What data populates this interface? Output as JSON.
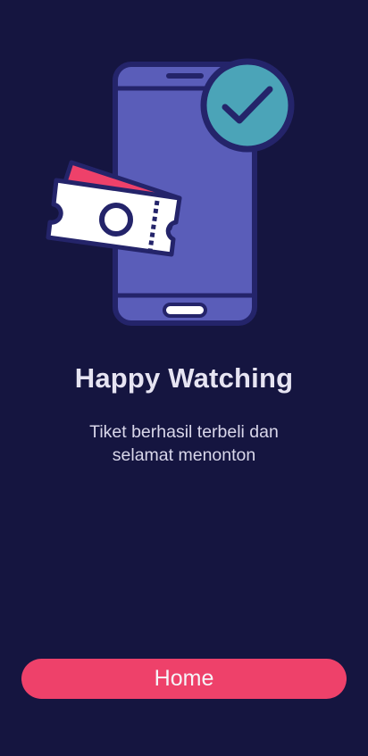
{
  "colors": {
    "background": "#151540",
    "phone_body": "#5A5DB9",
    "phone_outline": "#24246A",
    "check_badge": "#4BA4B8",
    "ticket_accent": "#EE416A",
    "button": "#EE416A"
  },
  "illustration": {
    "icons": [
      "smartphone-icon",
      "check-circle-icon",
      "ticket-icon"
    ]
  },
  "success": {
    "title": "Happy Watching",
    "message_line1": "Tiket berhasil terbeli dan",
    "message_line2": "selamat menonton"
  },
  "actions": {
    "home_label": "Home"
  }
}
